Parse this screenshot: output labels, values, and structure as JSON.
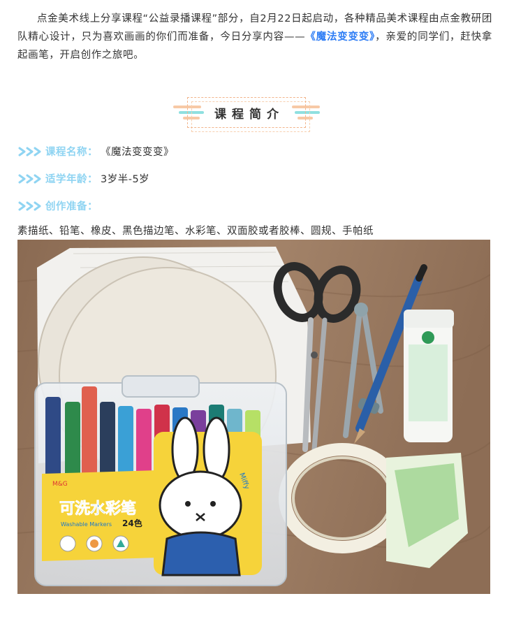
{
  "intro": {
    "before": "点金美术线上分享课程“公益录播课程”部分，自2月22日起启动，各种精品美术课程由点金教研团队精心设计，只为喜欢画画的你们而准备，今日分享内容——",
    "highlight": "《魔法变变变》",
    "after": "，亲爱的同学们，赶快拿起画笔，开启创作之旅吧。"
  },
  "section_title": "课程简介",
  "course": {
    "name_label": "课程名称：",
    "name_value": "《魔法变变变》",
    "age_label": "适学年龄：",
    "age_value": "3岁半-5岁",
    "prep_label": "创作准备：",
    "materials": "素描纸、铅笔、橡皮、黑色描边笔、水彩笔、双面胶或者胶棒、圆规、手帕纸"
  },
  "photo": {
    "marker_brand": "M&G",
    "marker_title": "可洗水彩笔",
    "marker_subtitle": "Washable Markers",
    "marker_count": "24色",
    "miffy": "Miffy"
  },
  "colors": {
    "highlight_blue": "#2e7df5",
    "label_cyan": "#8fd4f2",
    "accent_orange": "#f2b48b",
    "accent_teal": "#7fd8d8"
  }
}
